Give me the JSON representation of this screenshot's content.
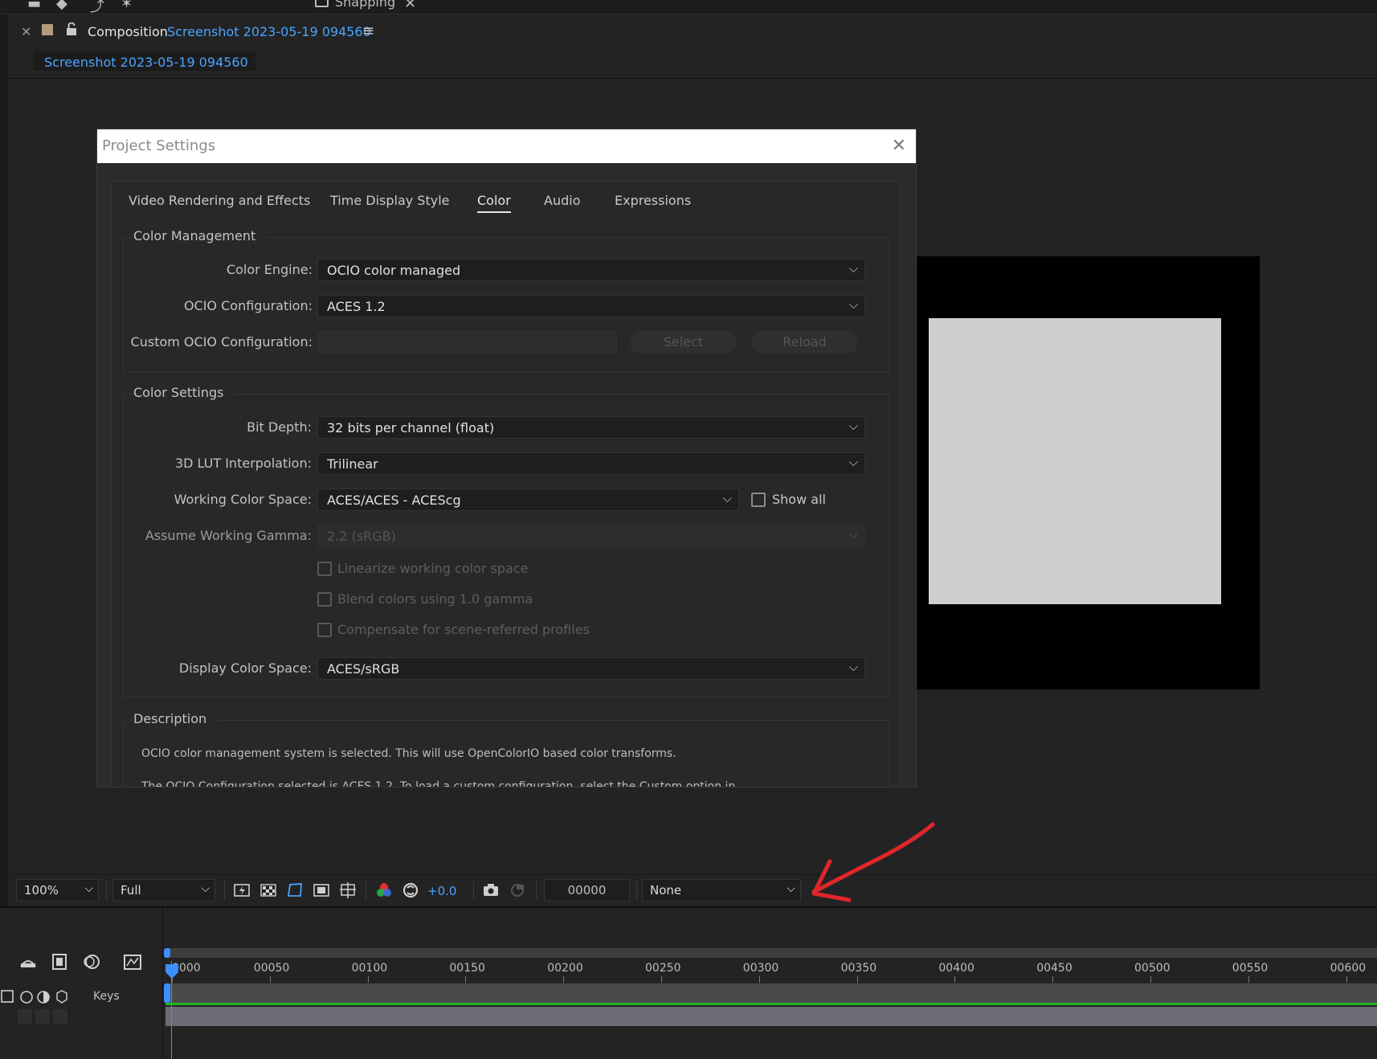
{
  "toolbar_top": {
    "snapping_label": "Snapping"
  },
  "comp_panel": {
    "panel_label": "Composition",
    "comp_name": "Screenshot 2023-05-19 094560",
    "tab_label": "Screenshot 2023-05-19 094560"
  },
  "dialog": {
    "title": "Project Settings",
    "tabs": [
      "Video Rendering and Effects",
      "Time Display Style",
      "Color",
      "Audio",
      "Expressions"
    ],
    "active_tab": "Color",
    "color_management": {
      "title": "Color Management",
      "color_engine_label": "Color Engine:",
      "color_engine_value": "OCIO color managed",
      "ocio_config_label": "OCIO Configuration:",
      "ocio_config_value": "ACES 1.2",
      "custom_ocio_label": "Custom OCIO Configuration:",
      "select_label": "Select",
      "reload_label": "Reload"
    },
    "color_settings": {
      "title": "Color Settings",
      "bit_depth_label": "Bit Depth:",
      "bit_depth_value": "32 bits per channel (float)",
      "lut_label": "3D LUT Interpolation:",
      "lut_value": "Trilinear",
      "working_space_label": "Working Color Space:",
      "working_space_value": "ACES/ACES - ACEScg",
      "show_all_label": "Show all",
      "gamma_label": "Assume Working Gamma:",
      "gamma_value": "2.2 (sRGB)",
      "linearize_label": "Linearize working color space",
      "blend_label": "Blend colors using 1.0 gamma",
      "compensate_label": "Compensate for scene-referred profiles",
      "display_space_label": "Display Color Space:",
      "display_space_value": "ACES/sRGB"
    },
    "description": {
      "title": "Description",
      "line1": "OCIO color management system is selected. This will use OpenColorIO based color transforms.",
      "line2": "The OCIO Configuration selected is ACES 1.2. To load a custom configuration, select the Custom option in"
    }
  },
  "viewer_bar": {
    "zoom": "100%",
    "resolution": "Full",
    "exposure": "+0.0",
    "timecode": "00000",
    "view_transform": "None"
  },
  "timeline": {
    "keys_label": "Keys",
    "ticks": [
      "0000",
      "00050",
      "00100",
      "00150",
      "00200",
      "00250",
      "00300",
      "00350",
      "00400",
      "00450",
      "00500",
      "00550",
      "00600"
    ]
  },
  "colors": {
    "accent_blue": "#4aa3ff",
    "annotation_red": "#e0262b",
    "layer_green": "#1fb41f"
  }
}
